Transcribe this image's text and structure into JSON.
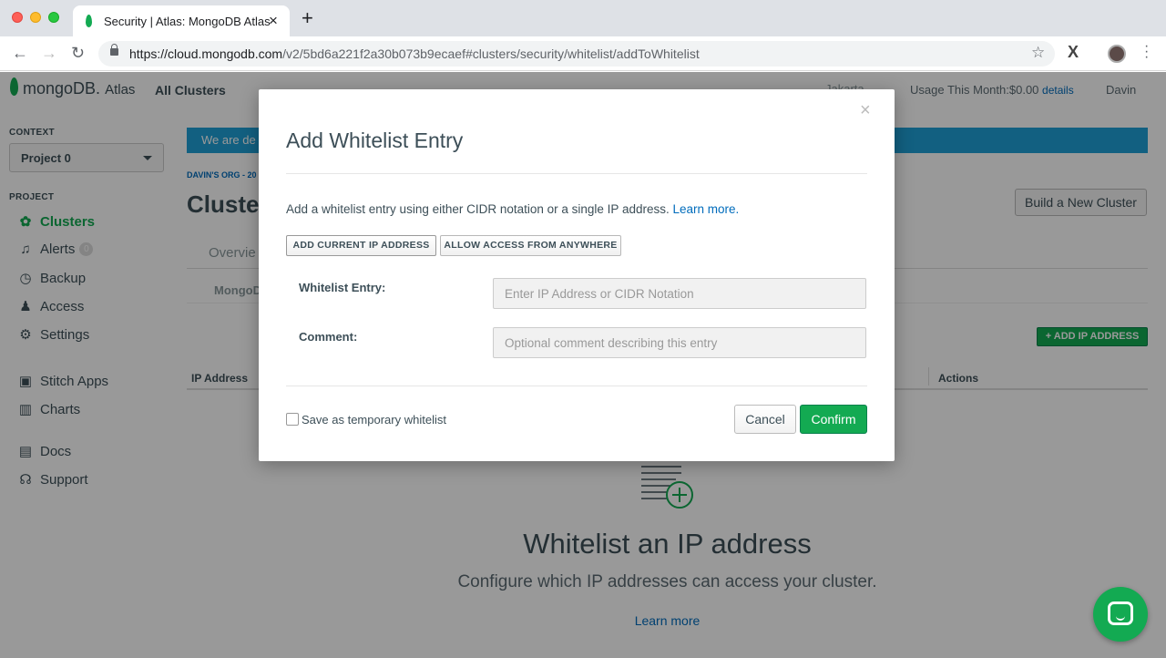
{
  "browser": {
    "tab_title": "Security | Atlas: MongoDB Atlas",
    "url_host": "https://cloud.mongodb.com",
    "url_path": "/v2/5bd6a221f2a30b073b9ecaef#clusters/security/whitelist/addToWhitelist"
  },
  "header": {
    "logo_text": "mongoDB.",
    "logo_suffix": "Atlas",
    "all_clusters": "All Clusters",
    "region": "Jakarta",
    "usage": "Usage This Month:$0.00",
    "usage_link": "details",
    "user": "Davin"
  },
  "sidebar": {
    "context_label": "CONTEXT",
    "project_selected": "Project 0",
    "project_label": "PROJECT",
    "items": [
      {
        "label": "Clusters",
        "icon": "clusters-icon"
      },
      {
        "label": "Alerts",
        "icon": "bell-icon",
        "badge": "0"
      },
      {
        "label": "Backup",
        "icon": "backup-icon"
      },
      {
        "label": "Access",
        "icon": "user-lock-icon"
      },
      {
        "label": "Settings",
        "icon": "gear-icon"
      },
      {
        "label": "Stitch Apps",
        "icon": "stitch-icon"
      },
      {
        "label": "Charts",
        "icon": "charts-icon"
      },
      {
        "label": "Docs",
        "icon": "book-icon"
      },
      {
        "label": "Support",
        "icon": "headset-icon"
      }
    ]
  },
  "main": {
    "banner_text": "We are de",
    "org_crumb": "DAVIN'S ORG - 20",
    "title": "Cluster",
    "build_button": "Build a New Cluster",
    "tab_overview": "Overvie",
    "subtab": "MongoD",
    "add_ip_button": "+ ADD IP ADDRESS",
    "table_headers": [
      "IP Address",
      "Actions"
    ],
    "empty_title": "Whitelist an IP address",
    "empty_subtitle": "Configure which IP addresses can access your cluster.",
    "empty_link": "Learn more"
  },
  "modal": {
    "title": "Add Whitelist Entry",
    "close": "×",
    "description": "Add a whitelist entry using either CIDR notation or a single IP address.",
    "learn_more": "Learn more.",
    "add_current_ip": "ADD CURRENT IP ADDRESS",
    "allow_anywhere": "ALLOW ACCESS FROM ANYWHERE",
    "entry_label": "Whitelist Entry:",
    "entry_placeholder": "Enter IP Address or CIDR Notation",
    "entry_value": "",
    "comment_label": "Comment:",
    "comment_placeholder": "Optional comment describing this entry",
    "comment_value": "",
    "temporary_label": "Save as temporary whitelist",
    "temporary_checked": false,
    "cancel": "Cancel",
    "confirm": "Confirm"
  },
  "colors": {
    "brand_green": "#13aa52",
    "link_blue": "#006cbc",
    "banner_blue": "#1fa0d8"
  }
}
